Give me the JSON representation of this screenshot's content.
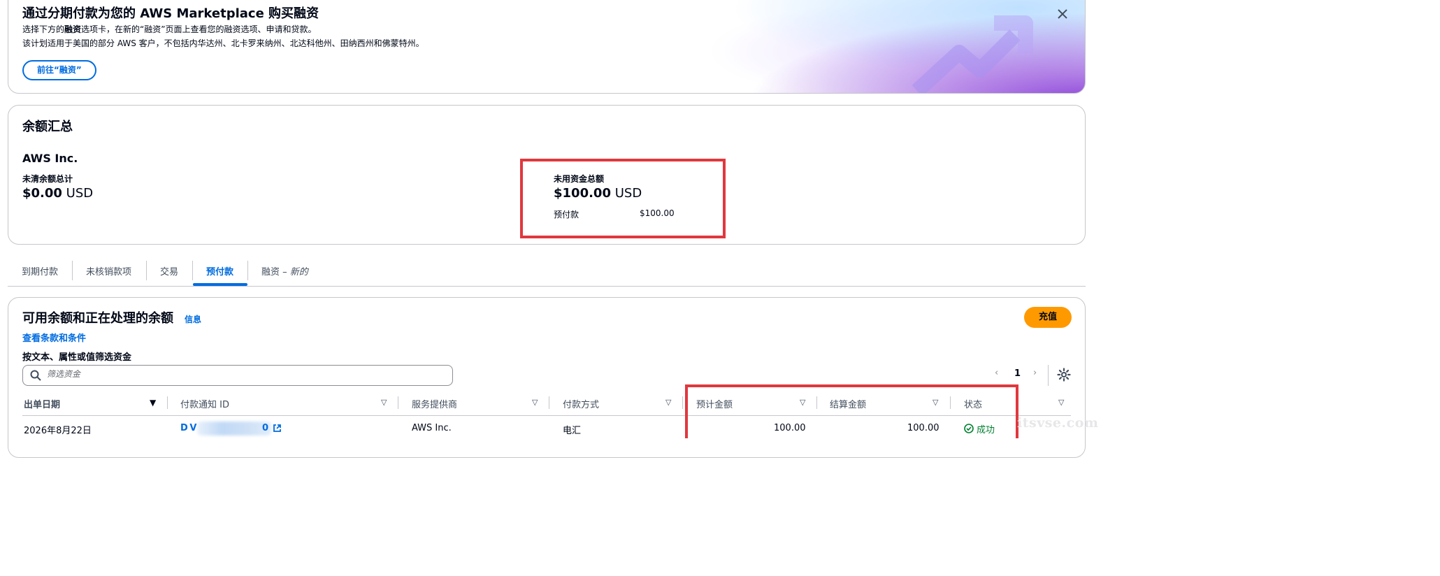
{
  "banner": {
    "title": "通过分期付款为您的 AWS Marketplace 购买融资",
    "line1_pre": "选择下方的",
    "line1_bold": "融资",
    "line1_post": "选项卡，在新的“融资”页面上查看您的融资选项、申请和贷款。",
    "line2": "该计划适用于美国的部分 AWS 客户，不包括内华达州、北卡罗来纳州、北达科他州、田纳西州和佛蒙特州。",
    "cta_label": "前往“融资”",
    "close_label": "×"
  },
  "summary": {
    "title": "余额汇总",
    "entity": "AWS Inc.",
    "outstanding_label": "未清余额总计",
    "outstanding_amount": "$0.00",
    "outstanding_currency": "USD",
    "unused_label": "未用资金总额",
    "unused_amount": "$100.00",
    "unused_currency": "USD",
    "prepay_label": "预付款",
    "prepay_amount": "$100.00"
  },
  "tabs": [
    {
      "label": "到期付款",
      "active": false
    },
    {
      "label": "未核销款项",
      "active": false
    },
    {
      "label": "交易",
      "active": false
    },
    {
      "label": "预付款",
      "active": true
    },
    {
      "label": "融资 – ",
      "suffix": "新的",
      "active": false
    }
  ],
  "funds": {
    "title": "可用余额和正在处理的余额",
    "info_link": "信息",
    "terms_link": "查看条款和条件",
    "filter_label": "按文本、属性或值筛选资金",
    "search_placeholder": "筛选资金",
    "topup_label": "充值",
    "page_current": "1",
    "prev_glyph": "‹",
    "next_glyph": "›",
    "columns": [
      "出单日期",
      "付款通知 ID",
      "服务提供商",
      "付款方式",
      "预计金额",
      "结算金额",
      "状态"
    ],
    "rows": [
      {
        "date": "2026年8月22日",
        "notice_id_start": "D V",
        "notice_id_end": "0",
        "provider": "AWS Inc.",
        "method": "电汇",
        "estimated": "100.00",
        "settled": "100.00",
        "status": "成功"
      }
    ]
  },
  "watermark": "itsvse.com",
  "colors": {
    "link": "#006ce0",
    "primary_button": "#ff9900",
    "success": "#00802f",
    "highlight_box": "#e0383e",
    "border": "#c6c6cd"
  }
}
